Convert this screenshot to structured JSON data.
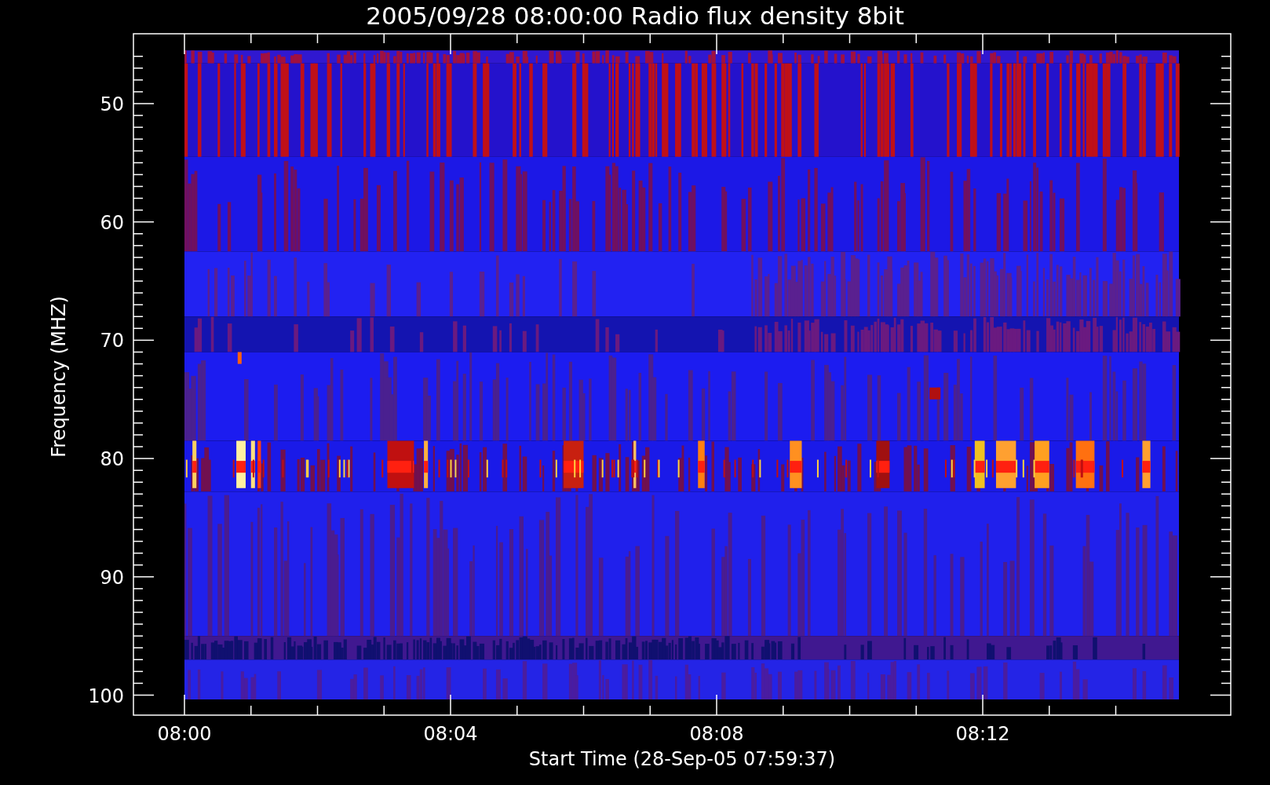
{
  "title": "2005/09/28 08:00:00 Radio flux density 8bit",
  "y_axis": {
    "label": "Frequency (MHZ)",
    "ticks": [
      "50",
      "60",
      "70",
      "80",
      "90",
      "100"
    ]
  },
  "x_axis": {
    "label": "Start Time (28-Sep-05 07:59:37)",
    "ticks": [
      "08:00",
      "08:04",
      "08:08",
      "08:12"
    ]
  }
}
